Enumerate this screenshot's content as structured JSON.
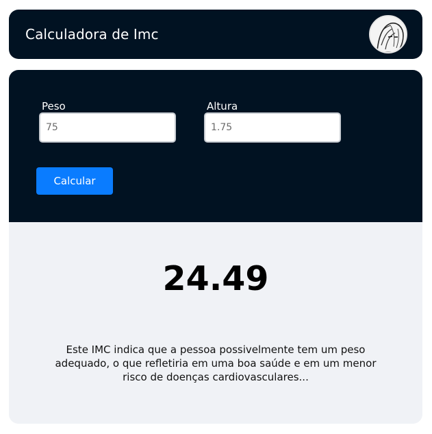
{
  "header": {
    "title": "Calculadora de Imc",
    "avatar_icon": "anime-avatar-icon"
  },
  "form": {
    "peso_label": "Peso",
    "peso_value": "75",
    "altura_label": "Altura",
    "altura_value": "1.75",
    "calculate_label": "Calcular"
  },
  "result": {
    "imc": "24.49",
    "description": "Este IMC indica que a pessoa possivelmente tem um peso adequado, o que refletiria em uma boa saúde e em um menor risco de doenças cardiovasculares..."
  },
  "colors": {
    "dark_bg": "#011222",
    "button": "#0a7cff",
    "result_bg": "#f0f2f6"
  }
}
